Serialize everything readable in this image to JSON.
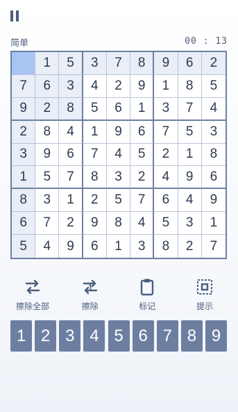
{
  "header": {
    "difficulty": "简单",
    "timer": "00 : 13"
  },
  "board": [
    [
      "",
      "1",
      "5",
      "3",
      "7",
      "8",
      "9",
      "6",
      "2"
    ],
    [
      "7",
      "6",
      "3",
      "4",
      "2",
      "9",
      "1",
      "8",
      "5"
    ],
    [
      "9",
      "2",
      "8",
      "5",
      "6",
      "1",
      "3",
      "7",
      "4"
    ],
    [
      "2",
      "8",
      "4",
      "1",
      "9",
      "6",
      "7",
      "5",
      "3"
    ],
    [
      "3",
      "9",
      "6",
      "7",
      "4",
      "5",
      "2",
      "1",
      "8"
    ],
    [
      "1",
      "5",
      "7",
      "8",
      "3",
      "2",
      "4",
      "9",
      "6"
    ],
    [
      "8",
      "3",
      "1",
      "2",
      "5",
      "7",
      "6",
      "4",
      "9"
    ],
    [
      "6",
      "7",
      "2",
      "9",
      "8",
      "4",
      "5",
      "3",
      "1"
    ],
    [
      "5",
      "4",
      "9",
      "6",
      "1",
      "3",
      "8",
      "2",
      "7"
    ]
  ],
  "selected_cell": {
    "row": 0,
    "col": 0
  },
  "tools": {
    "clear_all": "擦除全部",
    "erase": "擦除",
    "notes": "标记",
    "hint": "提示"
  },
  "numpad": [
    "1",
    "2",
    "3",
    "4",
    "5",
    "6",
    "7",
    "8",
    "9"
  ],
  "colors": {
    "accent": "#6d7fa1",
    "selected": "#a9c4f3",
    "highlight": "#e9eef7",
    "text": "#2d3a52"
  }
}
